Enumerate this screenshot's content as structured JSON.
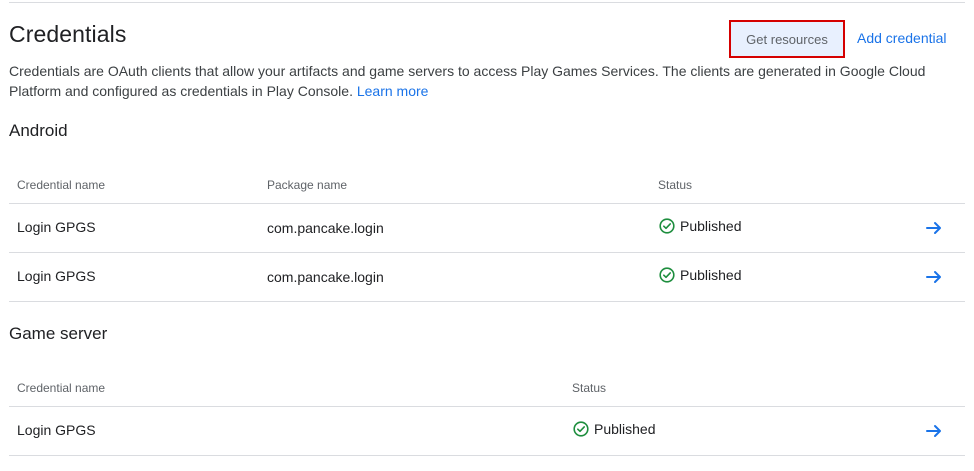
{
  "header": {
    "title": "Credentials",
    "get_resources_label": "Get resources",
    "add_credential_label": "Add credential",
    "description": "Credentials are OAuth clients that allow your artifacts and game servers to access Play Games Services. The clients are generated in Google Cloud Platform and configured as credentials in Play Console.",
    "learn_more_label": "Learn more"
  },
  "android": {
    "title": "Android",
    "columns": [
      "Credential name",
      "Package name",
      "Status"
    ],
    "rows": [
      {
        "name": "Login GPGS",
        "package": "com.pancake.login",
        "status": "Published"
      },
      {
        "name": "Login GPGS",
        "package": "com.pancake.login",
        "status": "Published"
      }
    ]
  },
  "game_server": {
    "title": "Game server",
    "columns": [
      "Credential name",
      "Status"
    ],
    "rows": [
      {
        "name": "Login GPGS",
        "status": "Published"
      }
    ]
  },
  "icons": {
    "status_icon": "check-circle-icon",
    "row_action_icon": "arrow-right-icon",
    "status_color": "#1e8e3e",
    "accent_color": "#1a73e8",
    "highlight_border_color": "#d50000"
  }
}
